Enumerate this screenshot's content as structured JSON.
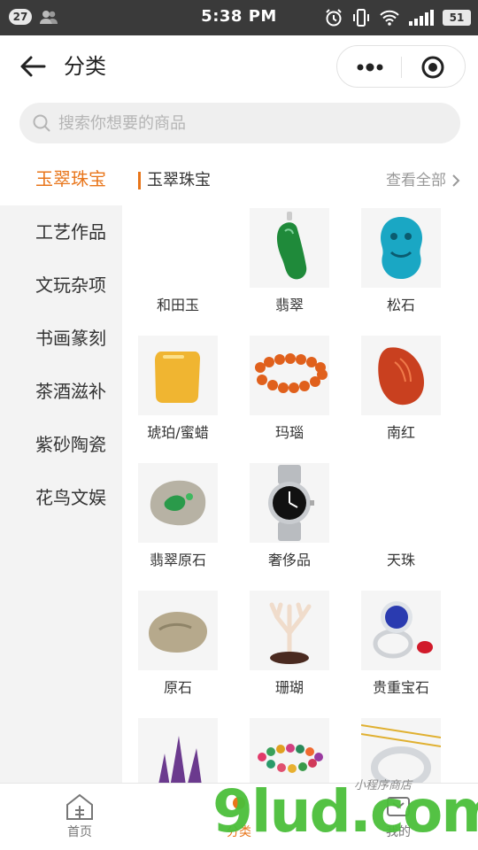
{
  "status_bar": {
    "notification_count": "27",
    "time": "5:38 PM",
    "battery": "51"
  },
  "header": {
    "title": "分类"
  },
  "search": {
    "placeholder": "搜索你想要的商品"
  },
  "sidebar": {
    "items": [
      {
        "label": "玉翠珠宝",
        "active": true
      },
      {
        "label": "工艺作品",
        "active": false
      },
      {
        "label": "文玩杂项",
        "active": false
      },
      {
        "label": "书画篆刻",
        "active": false
      },
      {
        "label": "茶酒滋补",
        "active": false
      },
      {
        "label": "紫砂陶瓷",
        "active": false
      },
      {
        "label": "花鸟文娱",
        "active": false
      }
    ]
  },
  "section": {
    "title": "玉翠珠宝",
    "view_all": "查看全部"
  },
  "products": [
    {
      "label": "和田玉",
      "icon": "hetian-jade-image"
    },
    {
      "label": "翡翠",
      "icon": "jadeite-pendant-image"
    },
    {
      "label": "松石",
      "icon": "turquoise-carving-image"
    },
    {
      "label": "琥珀/蜜蜡",
      "icon": "amber-block-image"
    },
    {
      "label": "玛瑙",
      "icon": "agate-bracelet-image"
    },
    {
      "label": "南红",
      "icon": "red-agate-carving-image"
    },
    {
      "label": "翡翠原石",
      "icon": "rough-jadeite-image"
    },
    {
      "label": "奢侈品",
      "icon": "luxury-watch-image"
    },
    {
      "label": "天珠",
      "icon": "dzi-bead-image"
    },
    {
      "label": "原石",
      "icon": "raw-stone-image"
    },
    {
      "label": "珊瑚",
      "icon": "coral-image"
    },
    {
      "label": "贵重宝石",
      "icon": "sapphire-ring-image"
    },
    {
      "label": "",
      "icon": "amethyst-cluster-image"
    },
    {
      "label": "",
      "icon": "tourmaline-bracelet-image"
    },
    {
      "label": "",
      "icon": "silver-bangle-image"
    }
  ],
  "tabbar": {
    "items": [
      {
        "label": "首页",
        "icon": "home-icon"
      },
      {
        "label": "分类",
        "icon": "category-icon"
      },
      {
        "label": "我的",
        "icon": "profile-icon"
      }
    ]
  },
  "watermark": {
    "text": "9lud.com",
    "sub": "小程序商店"
  },
  "colors": {
    "accent": "#e8751a",
    "status_bar": "#3a3a3a",
    "sidebar_bg": "#f3f3f3",
    "search_bg": "#efefef"
  }
}
